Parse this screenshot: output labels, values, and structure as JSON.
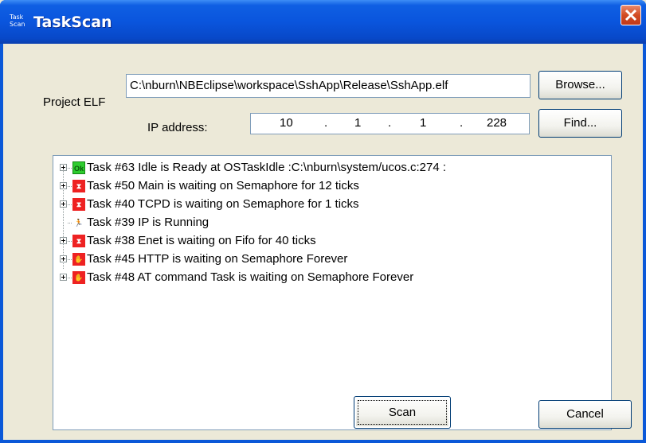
{
  "window": {
    "title": "TaskScan",
    "app_icon_text": "Task Scan"
  },
  "form": {
    "project_elf_label": "Project ELF",
    "project_elf_value": "C:\\nburn\\NBEclipse\\workspace\\SshApp\\Release\\SshApp.elf",
    "browse_label": "Browse...",
    "ip_label": "IP address:",
    "ip_octets": [
      "10",
      "1",
      "1",
      "228"
    ],
    "find_label": "Find..."
  },
  "tasks": [
    {
      "icon": "ok-icon",
      "icon_text": "Ok",
      "text": "Task #63 Idle is Ready at OSTaskIdle :C:\\nburn\\system/ucos.c:274 :",
      "expandable": true
    },
    {
      "icon": "hourglass-icon",
      "icon_text": "⧗",
      "text": "Task #50 Main is waiting on Semaphore for 12 ticks",
      "expandable": true
    },
    {
      "icon": "hourglass-icon",
      "icon_text": "⧗",
      "text": "Task #40 TCPD is waiting on Semaphore for 1 ticks",
      "expandable": true
    },
    {
      "icon": "running-icon",
      "icon_text": "🏃",
      "text": "Task #39 IP is Running",
      "expandable": false
    },
    {
      "icon": "hourglass-icon",
      "icon_text": "⧗",
      "text": "Task #38 Enet is waiting on Fifo for 40 ticks",
      "expandable": true
    },
    {
      "icon": "stop-hand-icon",
      "icon_text": "✋",
      "text": "Task #45 HTTP is waiting on Semaphore Forever",
      "expandable": true
    },
    {
      "icon": "stop-hand-icon",
      "icon_text": "✋",
      "text": "Task #48 AT command Task is waiting on Semaphore Forever",
      "expandable": true
    }
  ],
  "buttons": {
    "scan_label": "Scan",
    "cancel_label": "Cancel"
  },
  "colors": {
    "titlebar": "#0a55dd",
    "dialog_bg": "#ece9d8",
    "close": "#d24b21"
  }
}
